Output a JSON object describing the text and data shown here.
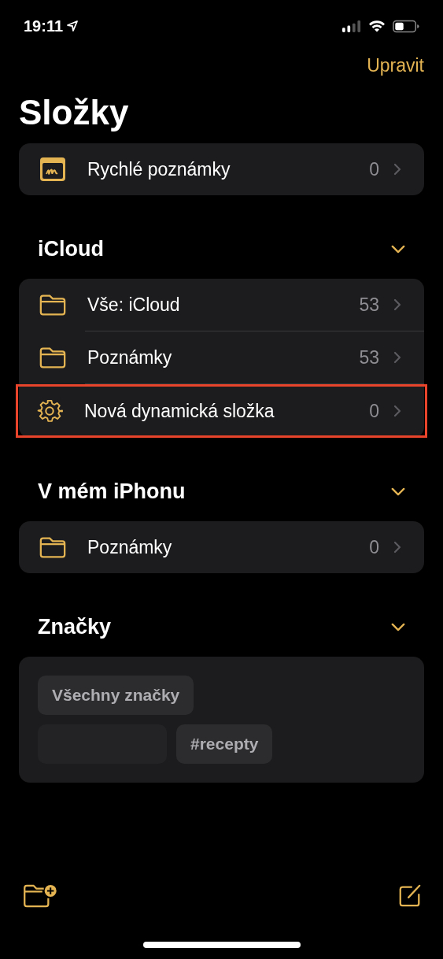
{
  "status_bar": {
    "time": "19:11"
  },
  "edit_button": "Upravit",
  "title": "Složky",
  "quick_notes": [
    {
      "kind": "quick",
      "label": "Rychlé poznámky",
      "count": "0",
      "highlighted": false
    }
  ],
  "sections": [
    {
      "title": "iCloud",
      "expanded": true,
      "items": [
        {
          "kind": "folder",
          "label": "Vše: iCloud",
          "count": "53",
          "highlighted": false
        },
        {
          "kind": "folder",
          "label": "Poznámky",
          "count": "53",
          "highlighted": false
        },
        {
          "kind": "smart",
          "label": "Nová dynamická složka",
          "count": "0",
          "highlighted": true
        }
      ]
    },
    {
      "title": "V mém iPhonu",
      "expanded": true,
      "items": [
        {
          "kind": "folder",
          "label": "Poznámky",
          "count": "0",
          "highlighted": false
        }
      ]
    }
  ],
  "tags": {
    "title": "Značky",
    "expanded": true,
    "items": [
      {
        "kind": "tag",
        "label": "Všechny značky"
      },
      {
        "kind": "blank"
      },
      {
        "kind": "tag",
        "label": "#recepty"
      }
    ]
  }
}
